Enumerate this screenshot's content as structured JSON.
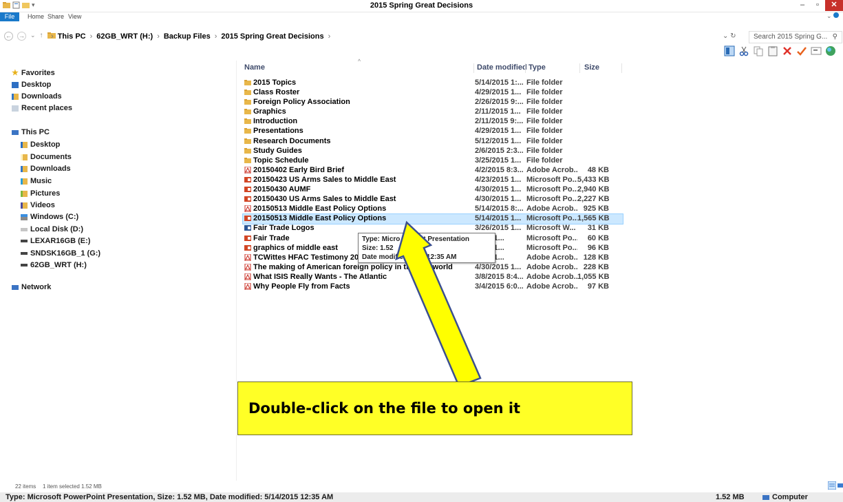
{
  "window": {
    "title": "2015 Spring Great Decisions",
    "minimize": "–",
    "maximize": "▫",
    "close": "✕"
  },
  "ribbon": {
    "tabs": [
      "File",
      "Home",
      "Share",
      "View"
    ],
    "expand": "⌄"
  },
  "address": {
    "back": "←",
    "forward": "→",
    "dropdown": "⌄",
    "up": "↑",
    "crumbs": [
      "This PC",
      "62GB_WRT (H:)",
      "Backup Files",
      "2015 Spring Great Decisions"
    ],
    "refresh": "⌄  ↻",
    "search_placeholder": "Search 2015 Spring G...",
    "search_icon": "⚲"
  },
  "nav": {
    "favorites": "Favorites",
    "desktop": "Desktop",
    "downloads": "Downloads",
    "recent": "Recent places",
    "this_pc": "This PC",
    "pc_desktop": "Desktop",
    "documents": "Documents",
    "pc_downloads": "Downloads",
    "music": "Music",
    "pictures": "Pictures",
    "videos": "Videos",
    "windows_c": "Windows (C:)",
    "local_d": "Local Disk (D:)",
    "lexar_e": "LEXAR16GB (E:)",
    "sndsk_g": "SNDSK16GB_1 (G:)",
    "wrt_h": "62GB_WRT (H:)",
    "network": "Network"
  },
  "columns": {
    "name": "Name",
    "date": "Date modified",
    "type": "Type",
    "size": "Size"
  },
  "files": [
    {
      "name": "2015 Topics",
      "date": "5/14/2015 1:...",
      "type": "File folder",
      "size": "",
      "icon": "folder-icon"
    },
    {
      "name": "Class Roster",
      "date": "4/29/2015 1...",
      "type": "File folder",
      "size": "",
      "icon": "folder-icon"
    },
    {
      "name": "Foreign Policy Association",
      "date": "2/26/2015 9:...",
      "type": "File folder",
      "size": "",
      "icon": "folder-icon"
    },
    {
      "name": "Graphics",
      "date": "2/11/2015 1...",
      "type": "File folder",
      "size": "",
      "icon": "folder-icon"
    },
    {
      "name": "Introduction",
      "date": "2/11/2015 9:...",
      "type": "File folder",
      "size": "",
      "icon": "folder-icon"
    },
    {
      "name": "Presentations",
      "date": "4/29/2015 1...",
      "type": "File folder",
      "size": "",
      "icon": "folder-icon"
    },
    {
      "name": "Research Documents",
      "date": "5/12/2015 1...",
      "type": "File folder",
      "size": "",
      "icon": "folder-icon"
    },
    {
      "name": "Study Guides",
      "date": "2/6/2015 2:3...",
      "type": "File folder",
      "size": "",
      "icon": "folder-icon"
    },
    {
      "name": "Topic Schedule",
      "date": "3/25/2015 1...",
      "type": "File folder",
      "size": "",
      "icon": "folder-icon"
    },
    {
      "name": "20150402 Early Bird Brief",
      "date": "4/2/2015 8:3...",
      "type": "Adobe Acrob...",
      "size": "48 KB",
      "icon": "pdf-icon"
    },
    {
      "name": "20150423 US Arms Sales to Middle East",
      "date": "4/23/2015 1...",
      "type": "Microsoft Po...",
      "size": "5,433 KB",
      "icon": "ppt-icon"
    },
    {
      "name": "20150430 AUMF",
      "date": "4/30/2015 1...",
      "type": "Microsoft Po...",
      "size": "2,940 KB",
      "icon": "ppt-icon"
    },
    {
      "name": "20150430 US Arms Sales to Middle East",
      "date": "4/30/2015 1...",
      "type": "Microsoft Po...",
      "size": "2,227 KB",
      "icon": "ppt-icon"
    },
    {
      "name": "20150513 Middle East Policy Options",
      "date": "5/14/2015 8:...",
      "type": "Adobe Acrob...",
      "size": "925 KB",
      "icon": "pdf-icon"
    },
    {
      "name": "20150513 Middle East Policy Options",
      "date": "5/14/2015 1...",
      "type": "Microsoft Po...",
      "size": "1,565 KB",
      "icon": "ppt-icon",
      "selected": true
    },
    {
      "name": "Fair Trade Logos",
      "date": "3/26/2015 1...",
      "type": "Microsoft W...",
      "size": "31 KB",
      "icon": "word-icon"
    },
    {
      "name": "Fair Trade",
      "date": "2015 1...",
      "type": "Microsoft Po...",
      "size": "60 KB",
      "icon": "ppt-icon"
    },
    {
      "name": "graphics of middle east",
      "date": "2015 1...",
      "type": "Microsoft Po...",
      "size": "96 KB",
      "icon": "ppt-icon"
    },
    {
      "name": "TCWittes HFAC Testimony 20150",
      "date": "2015 1...",
      "type": "Adobe Acrob...",
      "size": "128 KB",
      "icon": "pdf-icon"
    },
    {
      "name": "The making of American foreign policy in the pos world",
      "date": "4/30/2015 1...",
      "type": "Adobe Acrob...",
      "size": "228 KB",
      "icon": "pdf-icon"
    },
    {
      "name": "What ISIS Really Wants - The Atlantic",
      "date": "3/8/2015 8:4...",
      "type": "Adobe Acrob...",
      "size": "1,055 KB",
      "icon": "pdf-icon"
    },
    {
      "name": "Why People Fly from Facts",
      "date": "3/4/2015 6:0...",
      "type": "Adobe Acrob...",
      "size": "97 KB",
      "icon": "pdf-icon"
    }
  ],
  "tooltip": {
    "type": "Type: Micro          erPoint Presentation",
    "size": "Size: 1.52",
    "date": "Date modified          2015 12:35 AM"
  },
  "callout": {
    "text": "Double-click on the file to open it"
  },
  "status": {
    "items": "22 items",
    "selected": "1 item selected  1.52 MB",
    "details": "Type: Microsoft PowerPoint Presentation, Size: 1.52 MB, Date modified: 5/14/2015 12:35 AM",
    "size": "1.52 MB",
    "computer": "Computer"
  },
  "colors": {
    "file_tab": "#1979ca",
    "selection": "#cce8ff",
    "callout": "#ffff26",
    "arrow_fill": "#ffff00",
    "arrow_stroke": "#3b4f8f",
    "close": "#c7302a"
  }
}
